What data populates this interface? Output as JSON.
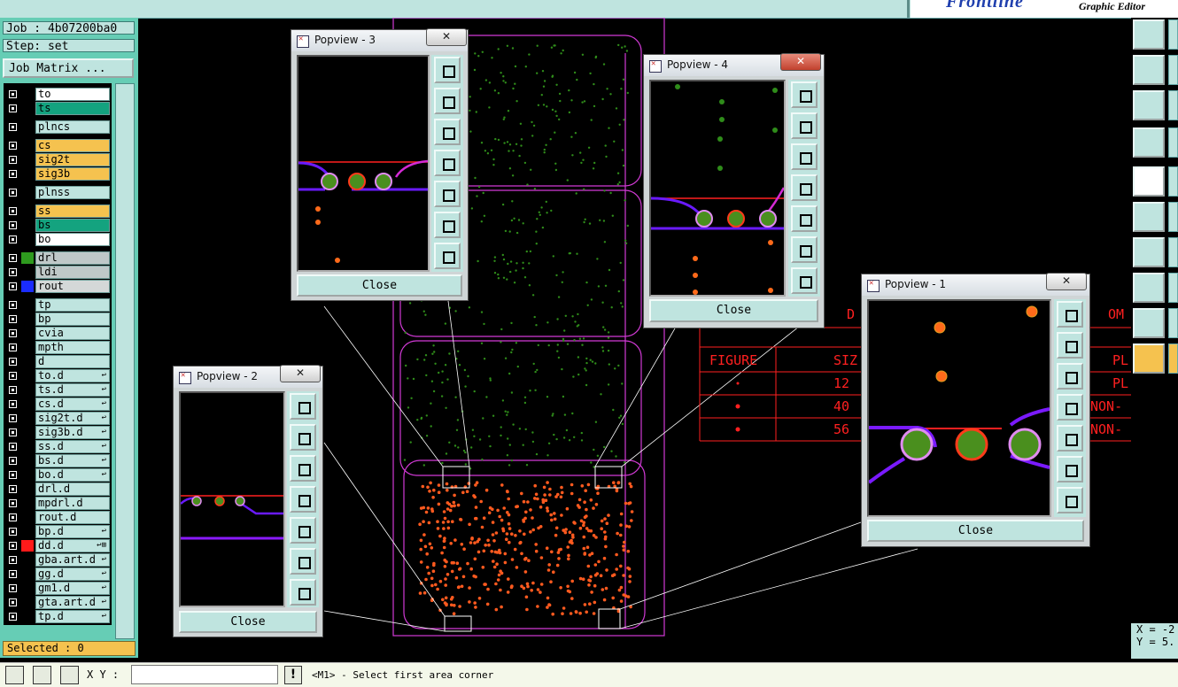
{
  "app": {
    "title": "Graphic Editor",
    "brand": "Frontline"
  },
  "info": {
    "job": "Job : 4b07200ba0",
    "step": "Step: set",
    "job_matrix": "Job Matrix ...",
    "selected": "Selected : 0"
  },
  "layers": [
    {
      "name": "to",
      "bg": "#ffffff",
      "color": null,
      "mark": ""
    },
    {
      "name": "ts",
      "bg": "#14a37f",
      "color": null,
      "mark": ""
    },
    {
      "name": "plncs",
      "bg": "#bfe4df",
      "color": null,
      "mark": ""
    },
    {
      "name": "cs",
      "bg": "#f5c24f",
      "color": null,
      "mark": ""
    },
    {
      "name": "sig2t",
      "bg": "#f5c24f",
      "color": null,
      "mark": ""
    },
    {
      "name": "sig3b",
      "bg": "#f5c24f",
      "color": null,
      "mark": ""
    },
    {
      "name": "plnss",
      "bg": "#bfe4df",
      "color": null,
      "mark": ""
    },
    {
      "name": "ss",
      "bg": "#f5c24f",
      "color": null,
      "mark": ""
    },
    {
      "name": "bs",
      "bg": "#14a37f",
      "color": null,
      "mark": ""
    },
    {
      "name": "bo",
      "bg": "#ffffff",
      "color": null,
      "mark": ""
    },
    {
      "name": "drl",
      "bg": "#bfc8c8",
      "color": "#2e9a1e",
      "mark": ""
    },
    {
      "name": "ldi",
      "bg": "#bfc8c8",
      "color": null,
      "mark": ""
    },
    {
      "name": "rout",
      "bg": "#d4d8d8",
      "color": "#1a2cff",
      "mark": ""
    },
    {
      "name": "tp",
      "bg": "#bfe4df",
      "color": null,
      "mark": ""
    },
    {
      "name": "bp",
      "bg": "#bfe4df",
      "color": null,
      "mark": ""
    },
    {
      "name": "cvia",
      "bg": "#bfe4df",
      "color": null,
      "mark": ""
    },
    {
      "name": "mpth",
      "bg": "#bfe4df",
      "color": null,
      "mark": ""
    },
    {
      "name": "d",
      "bg": "#bfe4df",
      "color": null,
      "mark": ""
    },
    {
      "name": "to.d",
      "bg": "#bfe4df",
      "color": null,
      "mark": "↩"
    },
    {
      "name": "ts.d",
      "bg": "#bfe4df",
      "color": null,
      "mark": "↩"
    },
    {
      "name": "cs.d",
      "bg": "#bfe4df",
      "color": null,
      "mark": "↩"
    },
    {
      "name": "sig2t.d",
      "bg": "#bfe4df",
      "color": null,
      "mark": "↩"
    },
    {
      "name": "sig3b.d",
      "bg": "#bfe4df",
      "color": null,
      "mark": "↩"
    },
    {
      "name": "ss.d",
      "bg": "#bfe4df",
      "color": null,
      "mark": "↩"
    },
    {
      "name": "bs.d",
      "bg": "#bfe4df",
      "color": null,
      "mark": "↩"
    },
    {
      "name": "bo.d",
      "bg": "#bfe4df",
      "color": null,
      "mark": "↩"
    },
    {
      "name": "drl.d",
      "bg": "#bfe4df",
      "color": null,
      "mark": ""
    },
    {
      "name": "mpdrl.d",
      "bg": "#bfe4df",
      "color": null,
      "mark": ""
    },
    {
      "name": "rout.d",
      "bg": "#bfe4df",
      "color": null,
      "mark": ""
    },
    {
      "name": "bp.d",
      "bg": "#bfe4df",
      "color": null,
      "mark": "↩"
    },
    {
      "name": "dd.d",
      "bg": "#bfe4df",
      "color": "#ff1a1a",
      "mark": "↩⊞"
    },
    {
      "name": "gba.art.d",
      "bg": "#bfe4df",
      "color": null,
      "mark": "↩"
    },
    {
      "name": "gg.d",
      "bg": "#bfe4df",
      "color": null,
      "mark": "↩"
    },
    {
      "name": "gm1.d",
      "bg": "#bfe4df",
      "color": null,
      "mark": "↩"
    },
    {
      "name": "gta.art.d",
      "bg": "#bfe4df",
      "color": null,
      "mark": "↩"
    },
    {
      "name": "tp.d",
      "bg": "#bfe4df",
      "color": null,
      "mark": "↩"
    }
  ],
  "popups": [
    {
      "title": "Popview - 3",
      "close": "Close",
      "close_x": "✕"
    },
    {
      "title": "Popview - 4",
      "close": "Close",
      "close_x": "✕"
    },
    {
      "title": "Popview - 2",
      "close": "Close",
      "close_x": "✕"
    },
    {
      "title": "Popview - 1",
      "close": "Close",
      "close_x": "✕"
    }
  ],
  "table": {
    "headers": [
      "D",
      "FIGURE",
      "SIZ",
      "OM",
      "PL"
    ],
    "rows": [
      [
        "12",
        "PL"
      ],
      [
        "40",
        "NON-"
      ],
      [
        "56",
        "NON-"
      ]
    ]
  },
  "bottom": {
    "xy_label": "X Y :",
    "xy_value": "",
    "status": "<M1> - Select first area corner",
    "excl": "!"
  },
  "coords": {
    "x": "X = -2",
    "y": "Y = 5."
  }
}
